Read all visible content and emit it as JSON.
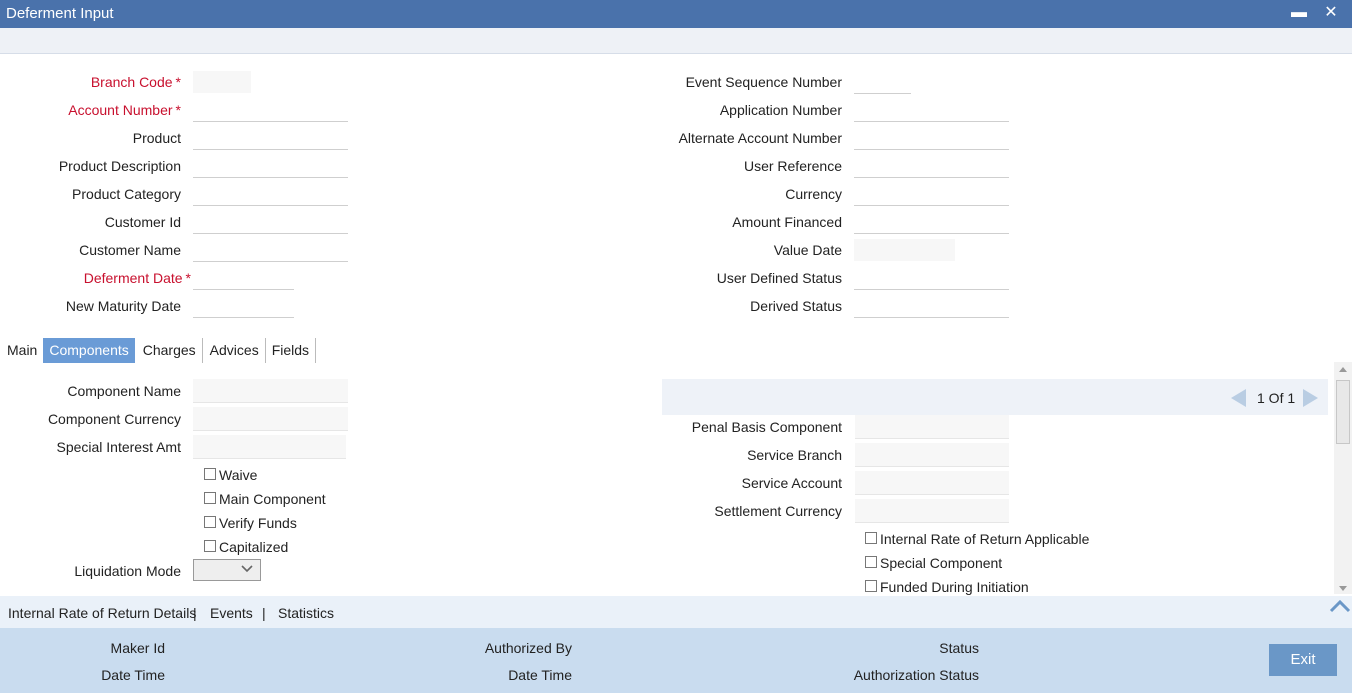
{
  "window": {
    "title": "Deferment Input",
    "minimize": "▬",
    "close": "✕"
  },
  "header_left": [
    {
      "label": "Branch Code",
      "required": true
    },
    {
      "label": "Account Number",
      "required": true
    },
    {
      "label": "Product",
      "required": false
    },
    {
      "label": "Product Description",
      "required": false
    },
    {
      "label": "Product Category",
      "required": false
    },
    {
      "label": "Customer Id",
      "required": false
    },
    {
      "label": "Customer Name",
      "required": false
    },
    {
      "label": "Deferment Date",
      "required": true
    },
    {
      "label": "New Maturity Date",
      "required": false
    }
  ],
  "header_right": [
    {
      "label": "Event Sequence Number"
    },
    {
      "label": "Application Number"
    },
    {
      "label": "Alternate Account Number"
    },
    {
      "label": "User Reference"
    },
    {
      "label": "Currency"
    },
    {
      "label": "Amount Financed"
    },
    {
      "label": "Value Date"
    },
    {
      "label": "User Defined Status"
    },
    {
      "label": "Derived Status"
    }
  ],
  "required_mark": "*",
  "tabs": [
    {
      "label": "Main",
      "active": false
    },
    {
      "label": "Components",
      "active": true
    },
    {
      "label": "Charges",
      "active": false
    },
    {
      "label": "Advices",
      "active": false
    },
    {
      "label": "Fields",
      "active": false
    }
  ],
  "components": {
    "left_fields": [
      {
        "label": "Component Name"
      },
      {
        "label": "Component Currency"
      },
      {
        "label": "Special Interest Amt"
      }
    ],
    "left_checkboxes": [
      {
        "label": "Waive",
        "checked": false
      },
      {
        "label": "Main Component",
        "checked": false
      },
      {
        "label": "Verify Funds",
        "checked": false
      },
      {
        "label": "Capitalized",
        "checked": false
      }
    ],
    "liquidation_mode_label": "Liquidation Mode",
    "liquidation_mode_value": "",
    "pager": {
      "text": "1 Of 1"
    },
    "right_fields": [
      {
        "label": "Penal Basis Component"
      },
      {
        "label": "Service Branch"
      },
      {
        "label": "Service Account"
      },
      {
        "label": "Settlement Currency"
      }
    ],
    "right_checkboxes": [
      {
        "label": "Internal Rate of Return Applicable",
        "checked": false
      },
      {
        "label": "Special Component",
        "checked": false
      },
      {
        "label": "Funded During Initiation",
        "checked": false
      }
    ]
  },
  "footer_links": [
    "Internal Rate of Return Details",
    "|",
    "Events",
    "|",
    "Statistics"
  ],
  "audit": {
    "maker_id": "Maker Id",
    "maker_date_time": "Date Time",
    "authorized_by": "Authorized By",
    "checker_date_time": "Date Time",
    "status": "Status",
    "authorization_status": "Authorization Status"
  },
  "exit_label": "Exit",
  "colors": {
    "titlebar": "#4a72ab",
    "accent": "#6a9bd6",
    "required": "#c8102e",
    "audit_bg": "#c9dcef"
  }
}
